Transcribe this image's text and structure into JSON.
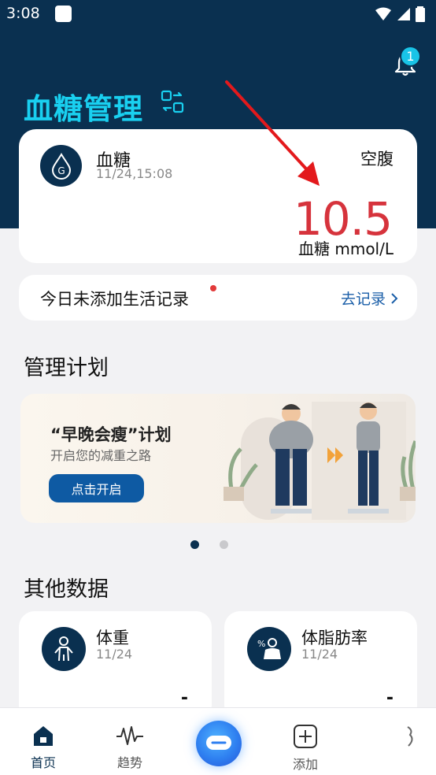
{
  "status_bar": {
    "time": "3:08"
  },
  "header": {
    "title": "血糖管理",
    "notification_count": "1"
  },
  "glucose_card": {
    "icon_letter": "G",
    "title": "血糖",
    "timestamp": "11/24,15:08",
    "tag": "空腹",
    "value": "10.5",
    "unit": "血糖 mmol/L",
    "value_color": "#d6333c"
  },
  "record_bar": {
    "text": "今日未添加生活记录",
    "link": "去记录"
  },
  "plan_section": {
    "title": "管理计划",
    "banner": {
      "title": "“早晚会瘦”计划",
      "subtitle": "开启您的减重之路",
      "button": "点击开启"
    },
    "carousel": {
      "count": 2,
      "active_index": 0
    }
  },
  "other_section": {
    "title": "其他数据",
    "cards": [
      {
        "icon": "person-icon",
        "title": "体重",
        "date": "11/24",
        "value": "-"
      },
      {
        "icon": "body-fat-icon",
        "title": "体脂肪率",
        "date": "11/24",
        "value": "-"
      }
    ]
  },
  "tabbar": {
    "items": [
      {
        "label": "首页",
        "icon": "home-icon",
        "active": true
      },
      {
        "label": "趋势",
        "icon": "pulse-icon",
        "active": false
      },
      {
        "label": "添加",
        "icon": "add-icon",
        "active": false
      }
    ]
  },
  "colors": {
    "header": "#0a3050",
    "accent": "#19d0f0",
    "primary_button": "#0e5aa3",
    "alert": "#d6333c"
  }
}
